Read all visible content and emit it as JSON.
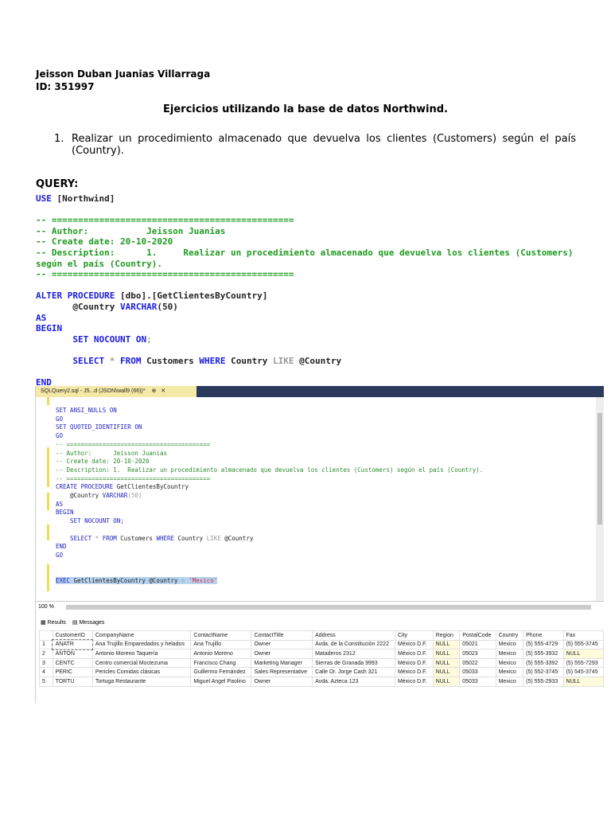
{
  "header": {
    "author": "Jeisson Duban Juanias Villarraga",
    "id": "ID: 351997"
  },
  "title": "Ejercicios utilizando la base de datos Northwind.",
  "exercise": {
    "number": "1.",
    "text": "Realizar un procedimiento almacenado que devuelva los clientes (Customers) según el país (Country)."
  },
  "query_label": "QUERY:",
  "code_lines": [
    [
      [
        "USE",
        "kw"
      ],
      [
        " [Northwind]",
        "tx"
      ]
    ],
    [],
    [
      [
        "-- ==============================================",
        "cm"
      ]
    ],
    [
      [
        "-- Author:           Jeisson Juanias",
        "cm"
      ]
    ],
    [
      [
        "-- Create date: 20-10-2020",
        "cm"
      ]
    ],
    [
      [
        "-- Description:      1.     Realizar un procedimiento almacenado que devuelva los clientes (Customers)",
        "cm"
      ]
    ],
    [
      [
        "según el país (Country).",
        "cm"
      ]
    ],
    [
      [
        "-- ==============================================",
        "cm"
      ]
    ],
    [],
    [
      [
        "ALTER PROCEDURE",
        "kw"
      ],
      [
        " [dbo].[GetClientesByCountry]",
        "tx"
      ]
    ],
    [
      [
        "       @Country ",
        "tx"
      ],
      [
        "VARCHAR",
        "kw"
      ],
      [
        "(50)",
        "tx"
      ]
    ],
    [
      [
        "AS",
        "kw"
      ]
    ],
    [
      [
        "BEGIN",
        "kw"
      ]
    ],
    [
      [
        "       SET NOCOUNT ON",
        "kw"
      ],
      [
        ";",
        "gr"
      ]
    ],
    [],
    [
      [
        "       SELECT",
        "kw"
      ],
      [
        " * ",
        "gr"
      ],
      [
        "FROM",
        "kw"
      ],
      [
        " Customers ",
        "tx"
      ],
      [
        "WHERE",
        "kw"
      ],
      [
        " Country ",
        "tx"
      ],
      [
        "LIKE",
        "gr"
      ],
      [
        " @Country",
        "tx"
      ]
    ],
    [],
    [
      [
        "END",
        "kw"
      ]
    ]
  ],
  "ssms": {
    "tab_title": "SQLQuery2.sql - J5...d (JSON\\wall9 (66))*",
    "tab_pin": "⊕",
    "tab_close": "✕",
    "editor_lines": [
      [
        [
          "SET ANSI_NULLS ON",
          "kw"
        ]
      ],
      [
        [
          "GO",
          "kw"
        ]
      ],
      [
        [
          "SET QUOTED_IDENTIFIER ON",
          "kw"
        ]
      ],
      [
        [
          "GO",
          "kw"
        ]
      ],
      [
        [
          "-- ========================================",
          "cm"
        ]
      ],
      [
        [
          "-- Author:      Jeisson Juanias",
          "cm"
        ]
      ],
      [
        [
          "-- Create date: 20-10-2020",
          "cm"
        ]
      ],
      [
        [
          "-- Description: 1.  Realizar un procedimiento almacenado que devuelva los clientes (Customers) según el país (Country).",
          "cm"
        ]
      ],
      [
        [
          "-- ========================================",
          "cm"
        ]
      ],
      [
        [
          "CREATE PROCEDURE",
          "kw"
        ],
        [
          " GetClientesByCountry",
          "tx"
        ]
      ],
      [
        [
          "    @Country ",
          "tx"
        ],
        [
          "VARCHAR",
          "kw"
        ],
        [
          "(50)",
          "gr"
        ]
      ],
      [
        [
          "AS",
          "kw"
        ]
      ],
      [
        [
          "BEGIN",
          "kw"
        ]
      ],
      [
        [
          "    SET NOCOUNT ON;",
          "kw"
        ]
      ],
      [],
      [
        [
          "    SELECT",
          "kw"
        ],
        [
          " * ",
          "gr"
        ],
        [
          "FROM",
          "kw"
        ],
        [
          " Customers ",
          "tx"
        ],
        [
          "WHERE",
          "kw"
        ],
        [
          " Country ",
          "tx"
        ],
        [
          "LIKE",
          "gr"
        ],
        [
          " @Country",
          "tx"
        ]
      ],
      [
        [
          "END",
          "kw"
        ]
      ],
      [
        [
          "GO",
          "kw"
        ]
      ],
      [],
      [],
      [
        [
          "EXEC",
          "kw"
        ],
        [
          " GetClientesByCountry @Country ",
          "tx"
        ],
        [
          "=",
          "gr"
        ],
        [
          " 'Mexico'",
          "st"
        ]
      ]
    ],
    "zoom": "100 %",
    "results_tab": "Results",
    "messages_tab": "Messages",
    "columns": [
      "",
      "CustomerID",
      "CompanyName",
      "ContactName",
      "ContactTitle",
      "Address",
      "City",
      "Region",
      "PostalCode",
      "Country",
      "Phone",
      "Fax"
    ],
    "rows": [
      [
        "1",
        "ANATR",
        "Ana Trujillo Emparedados y helados",
        "Ana Trujillo",
        "Owner",
        "Avda. de la Constitución 2222",
        "México D.F.",
        "NULL",
        "05021",
        "Mexico",
        "(5) 555-4729",
        "(5) 555-3745"
      ],
      [
        "2",
        "ANTON",
        "Antonio Moreno Taquería",
        "Antonio Moreno",
        "Owner",
        "Mataderos  2312",
        "México D.F.",
        "NULL",
        "05023",
        "Mexico",
        "(5) 555-3932",
        "NULL"
      ],
      [
        "3",
        "CENTC",
        "Centro comercial Moctezuma",
        "Francisco Chang",
        "Marketing Manager",
        "Sierras de Granada 9993",
        "México D.F.",
        "NULL",
        "05022",
        "Mexico",
        "(5) 555-3392",
        "(5) 555-7293"
      ],
      [
        "4",
        "PERIC",
        "Pericles Comidas clásicas",
        "Guillermo Fernández",
        "Sales Representative",
        "Calle Dr. Jorge Cash 321",
        "México D.F.",
        "NULL",
        "05033",
        "Mexico",
        "(5) 552-3745",
        "(5) 545-3745"
      ],
      [
        "5",
        "TORTU",
        "Tortuga Restaurante",
        "Miguel Angel Paolino",
        "Owner",
        "Avda. Azteca 123",
        "México D.F.",
        "NULL",
        "05033",
        "Mexico",
        "(5) 555-2933",
        "NULL"
      ]
    ]
  }
}
